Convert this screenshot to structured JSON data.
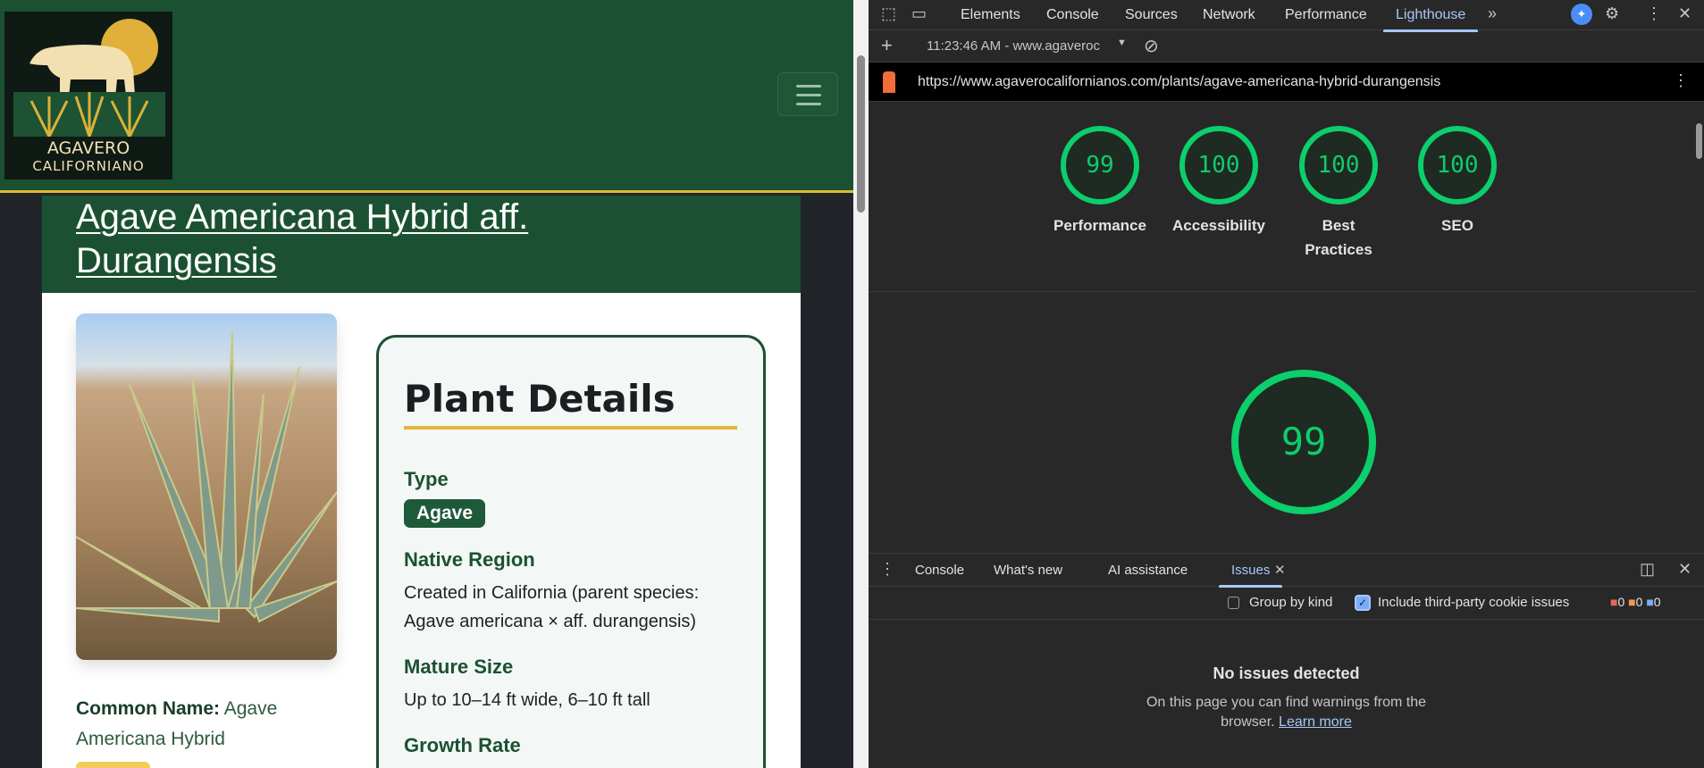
{
  "site": {
    "logo_text": [
      "AGAVERO",
      "CALIFORNIANO"
    ],
    "title": "Agave Americana Hybrid aff. Durangensis",
    "common_name_label": "Common Name:",
    "common_name_value": "Agave Americana Hybrid",
    "details": {
      "heading": "Plant Details",
      "type_label": "Type",
      "type_badge": "Agave",
      "region_label": "Native Region",
      "region_value": "Created in California (parent species: Agave americana × aff. durangensis)",
      "size_label": "Mature Size",
      "size_value": "Up to 10–14 ft wide, 6–10 ft tall",
      "growth_label": "Growth Rate"
    }
  },
  "devtools": {
    "tabs": [
      "Elements",
      "Console",
      "Sources",
      "Network",
      "Performance",
      "Lighthouse"
    ],
    "active_tab": "Lighthouse",
    "report_select": "11:23:46 AM - www.agaveroc",
    "url": "https://www.agaverocalifornianos.com/plants/agave-americana-hybrid-durangensis",
    "scores": [
      {
        "label": "Performance",
        "value": "99"
      },
      {
        "label": "Accessibility",
        "value": "100"
      },
      {
        "label": "Best Practices",
        "value": "100"
      },
      {
        "label": "SEO",
        "value": "100"
      }
    ],
    "main_score": "99",
    "accent": "#0cce6b",
    "drawer": {
      "tabs": [
        "Console",
        "What's new",
        "AI assistance",
        "Issues"
      ],
      "group_by_kind": "Group by kind",
      "include_cookie": "Include third-party cookie issues",
      "counts": {
        "errors": "0",
        "warnings": "0",
        "info": "0"
      },
      "empty_title": "No issues detected",
      "empty_text": "On this page you can find warnings from the browser.",
      "learn_more": "Learn more"
    }
  }
}
